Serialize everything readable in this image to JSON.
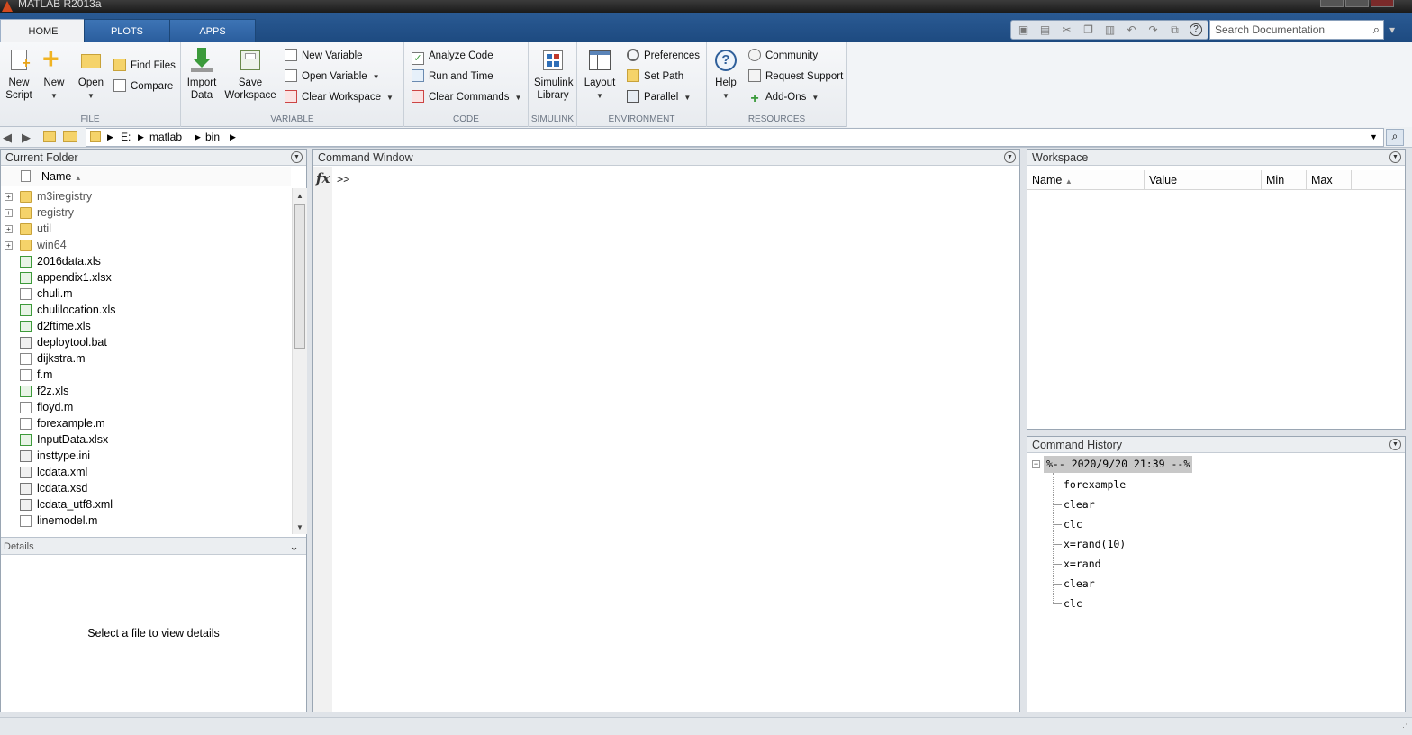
{
  "window": {
    "title": "MATLAB R2013a"
  },
  "tabs": [
    {
      "label": "HOME",
      "active": true
    },
    {
      "label": "PLOTS",
      "active": false
    },
    {
      "label": "APPS",
      "active": false
    }
  ],
  "search": {
    "placeholder": "Search Documentation"
  },
  "toolstrip": {
    "file": {
      "label": "FILE",
      "new_script": [
        "New",
        "Script"
      ],
      "new": "New",
      "open": "Open",
      "find_files": "Find Files",
      "compare": "Compare"
    },
    "variable": {
      "label": "VARIABLE",
      "import_data": [
        "Import",
        "Data"
      ],
      "save_workspace": [
        "Save",
        "Workspace"
      ],
      "new_variable": "New Variable",
      "open_variable": "Open Variable",
      "clear_workspace": "Clear Workspace"
    },
    "code": {
      "label": "CODE",
      "analyze_code": "Analyze Code",
      "run_and_time": "Run and Time",
      "clear_commands": "Clear Commands"
    },
    "simulink": {
      "label": "SIMULINK",
      "simulink_library": [
        "Simulink",
        "Library"
      ]
    },
    "environment": {
      "label": "ENVIRONMENT",
      "layout": "Layout",
      "preferences": "Preferences",
      "set_path": "Set Path",
      "parallel": "Parallel"
    },
    "resources": {
      "label": "RESOURCES",
      "help": "Help",
      "community": "Community",
      "request_support": "Request Support",
      "add_ons": "Add-Ons"
    }
  },
  "path": {
    "segments": [
      "E:",
      "matlab",
      "bin"
    ]
  },
  "current_folder": {
    "title": "Current Folder",
    "column_name": "Name",
    "files": [
      {
        "name": "m3iregistry",
        "type": "folder"
      },
      {
        "name": "registry",
        "type": "folder"
      },
      {
        "name": "util",
        "type": "folder"
      },
      {
        "name": "win64",
        "type": "folder"
      },
      {
        "name": "2016data.xls",
        "type": "xls"
      },
      {
        "name": "appendix1.xlsx",
        "type": "xls"
      },
      {
        "name": "chuli.m",
        "type": "m"
      },
      {
        "name": "chulilocation.xls",
        "type": "xls"
      },
      {
        "name": "d2ftime.xls",
        "type": "xls"
      },
      {
        "name": "deploytool.bat",
        "type": "bat"
      },
      {
        "name": "dijkstra.m",
        "type": "mfunc"
      },
      {
        "name": "f.m",
        "type": "mfunc"
      },
      {
        "name": "f2z.xls",
        "type": "xls"
      },
      {
        "name": "floyd.m",
        "type": "mfunc"
      },
      {
        "name": "forexample.m",
        "type": "mfunc"
      },
      {
        "name": "InputData.xlsx",
        "type": "xls"
      },
      {
        "name": "insttype.ini",
        "type": "ini"
      },
      {
        "name": "lcdata.xml",
        "type": "xml"
      },
      {
        "name": "lcdata.xsd",
        "type": "xsd"
      },
      {
        "name": "lcdata_utf8.xml",
        "type": "xml"
      },
      {
        "name": "linemodel.m",
        "type": "m"
      }
    ],
    "details_label": "Details",
    "details_message": "Select a file to view details"
  },
  "command_window": {
    "title": "Command Window",
    "prompt": ">>"
  },
  "workspace": {
    "title": "Workspace",
    "columns": [
      "Name",
      "Value",
      "Min",
      "Max"
    ]
  },
  "command_history": {
    "title": "Command History",
    "session": "%-- 2020/9/20 21:39 --%",
    "entries": [
      "forexample",
      "clear",
      "clc",
      "x=rand(10)",
      "x=rand",
      "clear",
      "clc"
    ]
  }
}
